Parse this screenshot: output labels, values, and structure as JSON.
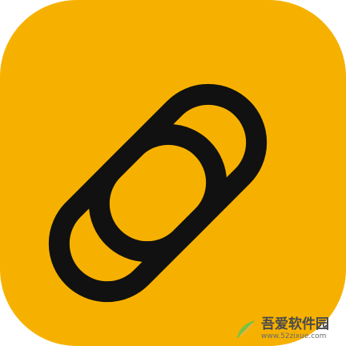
{
  "icon": {
    "name": "link-icon",
    "background_color": "#F6B100",
    "glyph_color": "#111111"
  },
  "watermark": {
    "title": "吾爱软件园",
    "url": "www.52zixue.com",
    "logo_colors": [
      "#7CC242",
      "#F2B233"
    ]
  }
}
